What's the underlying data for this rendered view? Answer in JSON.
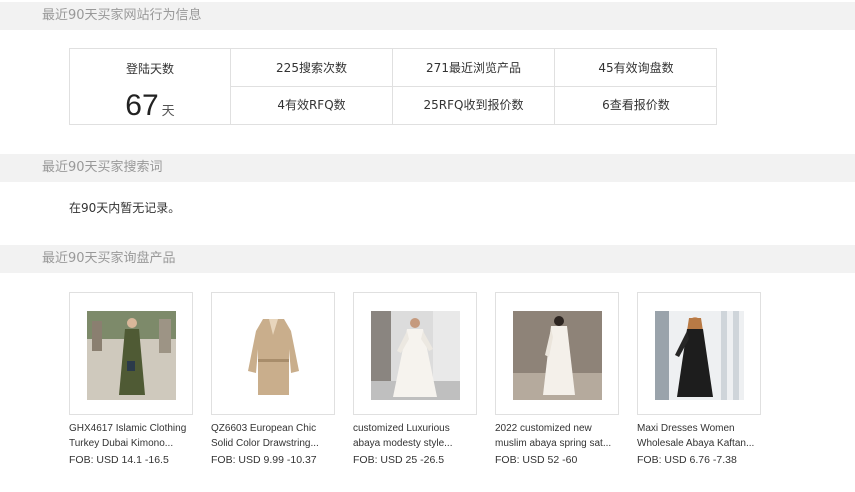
{
  "sections": {
    "behavior_title": "最近90天买家网站行为信息",
    "search_title": "最近90天买家搜索词",
    "inquiry_title": "最近90天买家询盘产品"
  },
  "stats": {
    "login_days_label": "登陆天数",
    "login_days_value": "67",
    "login_days_unit": "天",
    "searches": "225搜索次数",
    "recent_viewed": "271最近浏览产品",
    "valid_inquiries": "45有效询盘数",
    "valid_rfq": "4有效RFQ数",
    "rfq_quotes": "25RFQ收到报价数",
    "viewed_quotes": "6查看报价数"
  },
  "search_terms": {
    "empty_message": "在90天内暂无记录。"
  },
  "products": [
    {
      "line1": "GHX4617 Islamic Clothing",
      "line2": "Turkey Dubai Kimono...",
      "price": "FOB: USD 14.1 -16.5"
    },
    {
      "line1": "QZ6603 European Chic",
      "line2": "Solid Color Drawstring...",
      "price": "FOB: USD 9.99 -10.37"
    },
    {
      "line1": "customized Luxurious",
      "line2": "abaya modesty style...",
      "price": "FOB: USD 25 -26.5"
    },
    {
      "line1": "2022 customized new",
      "line2": "muslim abaya spring sat...",
      "price": "FOB: USD 52 -60"
    },
    {
      "line1": "Maxi Dresses Women",
      "line2": "Wholesale Abaya Kaftan...",
      "price": "FOB: USD 6.76 -7.38"
    }
  ]
}
